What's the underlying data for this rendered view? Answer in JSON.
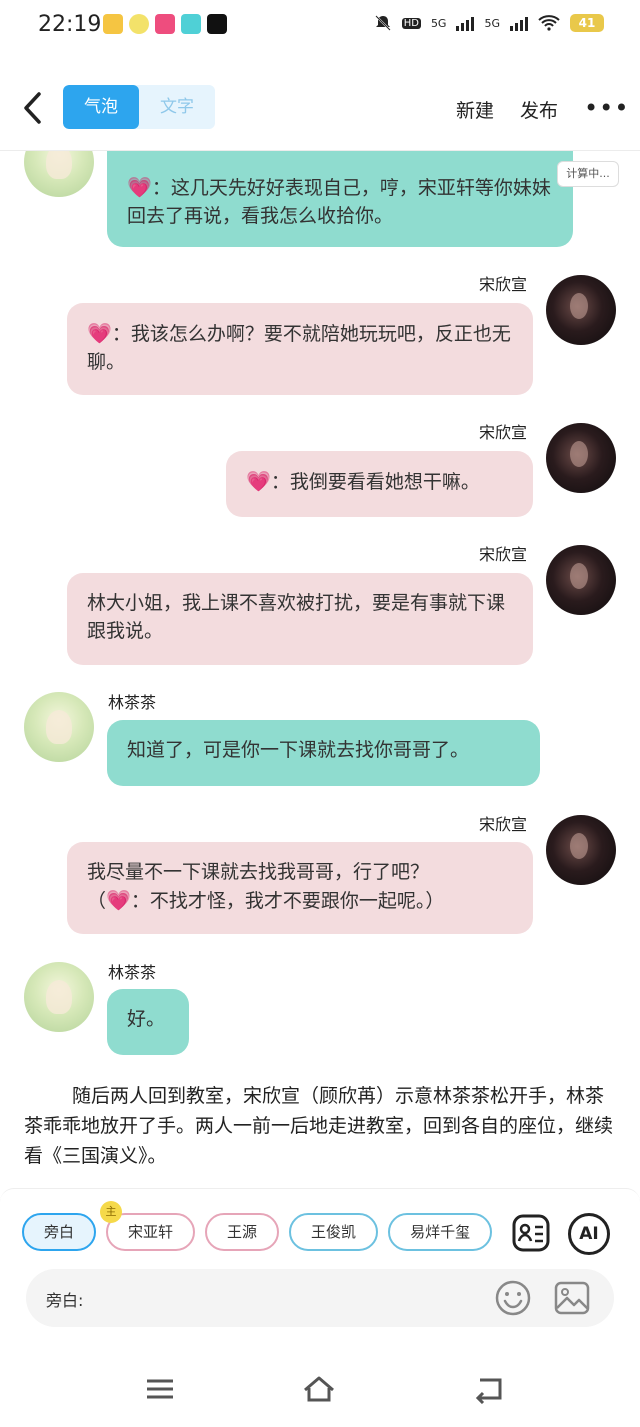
{
  "status": {
    "time": "22:19",
    "hd": "HD",
    "net1": "5G",
    "net2": "5G",
    "battery": "41"
  },
  "toolbar": {
    "tab_bubble": "气泡",
    "tab_text": "文字",
    "new_label": "新建",
    "publish_label": "发布",
    "more_label": "•••"
  },
  "chat": {
    "calc_label": "计算中...",
    "m1_text": "：这几天先好好表现自己，哼，宋亚轩等你妹妹回去了再说，看我怎么收拾你。",
    "m2_name": "宋欣宣",
    "m2_text": "：我该怎么办啊？要不就陪她玩玩吧，反正也无聊。",
    "m3_name": "宋欣宣",
    "m3_text": "：我倒要看看她想干嘛。",
    "m4_name": "宋欣宣",
    "m4_text": "林大小姐，我上课不喜欢被打扰，要是有事就下课跟我说。",
    "m5_name": "林茶茶",
    "m5_text": "知道了，可是你一下课就去找你哥哥了。",
    "m6_name": "宋欣宣",
    "m6_text_a": "我尽量不一下课就去找我哥哥，行了吧？",
    "m6_text_b": "（",
    "m6_text_c": "：不找才怪，我才不要跟你一起呢。）",
    "m7_name": "林茶茶",
    "m7_text": "好。",
    "narration": "随后两人回到教室，宋欣宣（顾欣苒）示意林茶茶松开手，林茶茶乖乖地放开了手。两人一前一后地走进教室，回到各自的座位，继续看《三国演义》。"
  },
  "panel": {
    "chips": [
      "旁白",
      "宋亚轩",
      "王源",
      "王俊凯",
      "易烊千玺"
    ],
    "crown_label": "主",
    "ai_label": "AI",
    "input_label": "旁白:"
  },
  "colors": {
    "accent": "#2da5ee",
    "teal_bubble": "#8fdccf",
    "pink_bubble": "#f3dcde"
  }
}
